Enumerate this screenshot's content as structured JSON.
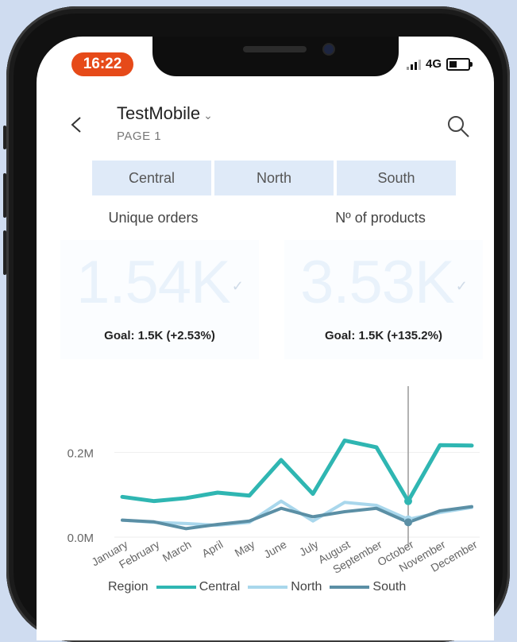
{
  "status_bar": {
    "time": "16:22",
    "network": "4G"
  },
  "header": {
    "title": "TestMobile",
    "title_chevron": "⌄",
    "page": "PAGE 1"
  },
  "slicer": [
    "Central",
    "North",
    "South"
  ],
  "kpis": [
    {
      "label": "Unique orders",
      "value": "1.54K",
      "goal": "Goal: 1.5K (+2.53%)"
    },
    {
      "label": "Nº of products",
      "value": "3.53K",
      "goal": "Goal: 1.5K (+135.2%)"
    }
  ],
  "colors": {
    "central": "#2fb6b2",
    "north": "#a9d7ec",
    "south": "#5b8fa5",
    "time_pill": "#e64a19"
  },
  "chart_data": {
    "type": "line",
    "categories": [
      "January",
      "February",
      "March",
      "April",
      "May",
      "June",
      "July",
      "August",
      "September",
      "October",
      "November",
      "December"
    ],
    "y_ticks": [
      "0.2M",
      "0.0M"
    ],
    "ylim": [
      0,
      0.3
    ],
    "series": [
      {
        "name": "Central",
        "color": "#2fb6b2",
        "values": [
          0.095,
          0.085,
          0.092,
          0.105,
          0.098,
          0.182,
          0.102,
          0.228,
          0.212,
          0.085,
          0.217,
          0.216
        ]
      },
      {
        "name": "North",
        "color": "#a9d7ec",
        "values": [
          0.04,
          0.035,
          0.032,
          0.028,
          0.035,
          0.085,
          0.038,
          0.082,
          0.075,
          0.042,
          0.058,
          0.07
        ]
      },
      {
        "name": "South",
        "color": "#5b8fa5",
        "values": [
          0.04,
          0.036,
          0.02,
          0.03,
          0.038,
          0.068,
          0.048,
          0.06,
          0.068,
          0.035,
          0.062,
          0.072
        ]
      }
    ],
    "legend": {
      "title": "Region",
      "position": "bottom"
    },
    "highlighted_category": "October"
  }
}
